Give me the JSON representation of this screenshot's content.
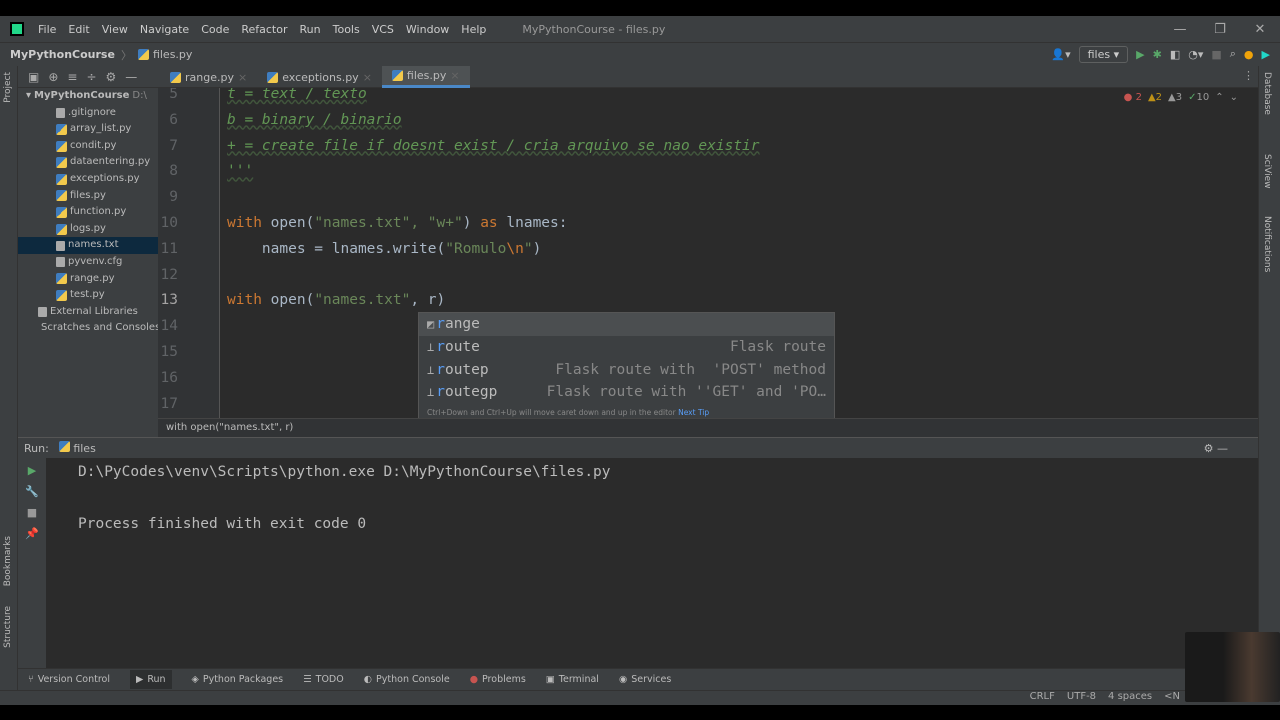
{
  "menu": [
    "File",
    "Edit",
    "View",
    "Navigate",
    "Code",
    "Refactor",
    "Run",
    "Tools",
    "VCS",
    "Window",
    "Help"
  ],
  "window_title": "MyPythonCourse - files.py",
  "nav": {
    "project": "MyPythonCourse",
    "file": "files.py",
    "run_config": "files"
  },
  "tabs": [
    {
      "label": "range.py",
      "active": false
    },
    {
      "label": "exceptions.py",
      "active": false
    },
    {
      "label": "files.py",
      "active": true
    }
  ],
  "project": {
    "root": "MyPythonCourse",
    "root_path": "D:\\",
    "files": [
      ".gitignore",
      "array_list.py",
      "condit.py",
      "dataentering.py",
      "exceptions.py",
      "files.py",
      "function.py",
      "logs.py",
      "names.txt",
      "pyvenv.cfg",
      "range.py",
      "test.py"
    ],
    "selected": "names.txt",
    "external": "External Libraries",
    "scratches": "Scratches and Consoles"
  },
  "inspections": {
    "errors": "2",
    "warnings": "2",
    "weak": "3",
    "ok": "10"
  },
  "code": [
    {
      "n": "5",
      "t": [
        [
          "doc",
          "t = text / texto"
        ]
      ]
    },
    {
      "n": "6",
      "t": [
        [
          "doc",
          "b = binary / binario"
        ]
      ]
    },
    {
      "n": "7",
      "t": [
        [
          "doc",
          "+ = create file if doesnt exist / cria arquivo se nao existir"
        ]
      ]
    },
    {
      "n": "8",
      "t": [
        [
          "doc",
          "'''"
        ]
      ]
    },
    {
      "n": "9",
      "t": []
    },
    {
      "n": "10",
      "t": [
        [
          "kw",
          "with "
        ],
        [
          "",
          "open("
        ],
        [
          "str",
          "\"names.txt\", \"w+\""
        ],
        [
          "",
          ") "
        ],
        [
          "kw",
          "as"
        ],
        [
          "",
          " lnames:"
        ]
      ]
    },
    {
      "n": "11",
      "t": [
        [
          "",
          "    names = lnames.write("
        ],
        [
          "str",
          "\"Romulo"
        ],
        [
          "esc",
          "\\n"
        ],
        [
          "str",
          "\""
        ],
        [
          "",
          ")"
        ]
      ]
    },
    {
      "n": "12",
      "t": []
    },
    {
      "n": "13",
      "t": [
        [
          "kw",
          "with "
        ],
        [
          "",
          "open("
        ],
        [
          "str",
          "\"names.txt\""
        ],
        [
          "",
          ", r)"
        ]
      ]
    },
    {
      "n": "14",
      "t": []
    },
    {
      "n": "15",
      "t": []
    },
    {
      "n": "16",
      "t": []
    },
    {
      "n": "17",
      "t": []
    }
  ],
  "completion": {
    "items": [
      {
        "name": "range",
        "desc": ""
      },
      {
        "name": "route",
        "desc": "Flask route"
      },
      {
        "name": "routep",
        "desc": "Flask route with  'POST' method"
      },
      {
        "name": "routegp",
        "desc": "Flask route with ''GET' and 'PO…"
      }
    ],
    "footer": "Ctrl+Down and Ctrl+Up will move caret down and up in the editor",
    "next_tip": "Next Tip"
  },
  "editor_breadcrumb": "with open(\"names.txt\", r)",
  "run": {
    "label": "Run:",
    "tab": "files",
    "lines": [
      "D:\\PyCodes\\venv\\Scripts\\python.exe D:\\MyPythonCourse\\files.py",
      "",
      "Process finished with exit code 0"
    ]
  },
  "side_left": [
    "Project",
    "Bookmarks",
    "Structure"
  ],
  "side_right": [
    "Database",
    "SciView",
    "Notifications"
  ],
  "bottom_tabs": [
    "Version Control",
    "Run",
    "Python Packages",
    "TODO",
    "Python Console",
    "Problems",
    "Terminal",
    "Services"
  ],
  "status": {
    "line_sep": "CRLF",
    "encoding": "UTF-8",
    "indent": "4 spaces",
    "interp": "<N"
  }
}
